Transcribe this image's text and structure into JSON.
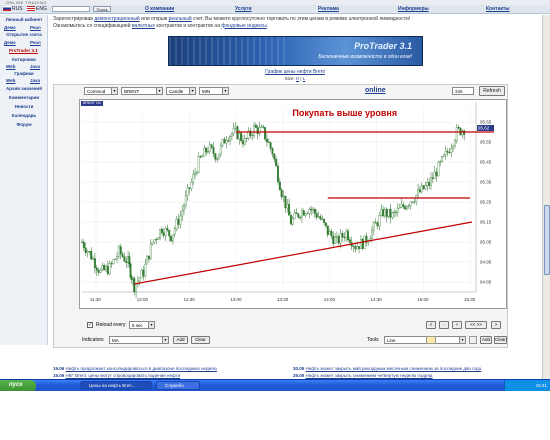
{
  "site": {
    "logo_text": "ONLINE TRADING"
  },
  "language": {
    "ru": "RUS",
    "en": "ENG"
  },
  "nav": {
    "search_button": "Поиск",
    "items": [
      "О компании",
      "Услуги",
      "Реклама",
      "Информеры",
      "Контакты"
    ]
  },
  "sidebar": {
    "sections": [
      {
        "title": "Личный кабинет",
        "links": [
          "Демо",
          "Реал"
        ]
      },
      {
        "title": "Открытие счета",
        "links": [
          "Демо",
          "Реал"
        ]
      },
      {
        "title": "",
        "links": [
          "ProTrader 3.1"
        ]
      },
      {
        "title": "Котировки",
        "links": [
          "Web",
          "Java"
        ]
      },
      {
        "title": "Графики",
        "links": [
          "Web",
          "Java"
        ]
      },
      {
        "title": "Архив значений",
        "links": []
      },
      {
        "title": "Комментарии",
        "links": []
      },
      {
        "title": "Новости",
        "links": []
      },
      {
        "title": "Календарь",
        "links": []
      },
      {
        "title": "Форум",
        "links": []
      }
    ]
  },
  "intro": {
    "line1_a": "Зарегистрировав ",
    "line1_link1": "демонстрационный",
    "line1_b": " или открыв ",
    "line1_link2": "реальный",
    "line1_c": " счет, Вы можете круглосуточно торговать по этим ценам в режиме электронной ликвидности!",
    "line2_a": "Ознакомьтесь со спецификацией ",
    "line2_link1": "валютных",
    "line2_b": " контрактов и контрактов на ",
    "line2_link2": "фондовые индексы",
    "line2_c": "."
  },
  "banner": {
    "title": "ProTrader 3.1",
    "subtitle": "Бесконечные возможности в один клик!"
  },
  "chart_header": {
    "title": "График цены нефти Brent",
    "size_label": "Size:",
    "size_h": "H",
    "size_l": "L"
  },
  "controls": {
    "type": "Commod",
    "symbol": "BRENT",
    "style": "Candle",
    "interval": "MIN",
    "online": "online",
    "periods": "336",
    "refresh": "Refresh",
    "reload_label": "Reload every",
    "reload_value": "5 sec",
    "reload_checked": true,
    "indicators_label": "Indicators",
    "indicator_value": "MA",
    "add": "Add",
    "clear": "Clear",
    "tools_label": "Tools",
    "tool_value": "Line",
    "nav_buttons": [
      "<",
      "-",
      "+",
      "<< >>",
      ">"
    ]
  },
  "chart_data": {
    "type": "candlestick",
    "symbol_tag": "BRENT 1M",
    "annotation": "Покупать выше уровня",
    "x_ticks": [
      "11:30",
      "12:00",
      "12:30",
      "13:00",
      "13:30",
      "14:00",
      "14:30",
      "15:00",
      "15:30"
    ],
    "y_ticks": [
      "94.85",
      "94.95",
      "95.05",
      "95.15",
      "95.25",
      "95.35",
      "95.45",
      "95.55",
      "95.65"
    ],
    "ylim": [
      94.8,
      95.72
    ],
    "last_price": "95.62",
    "close_path": [
      [
        0,
        95.05
      ],
      [
        6,
        94.98
      ],
      [
        12,
        94.9
      ],
      [
        18,
        94.92
      ],
      [
        24,
        95.0
      ],
      [
        30,
        94.95
      ],
      [
        34,
        94.83
      ],
      [
        40,
        94.9
      ],
      [
        46,
        95.05
      ],
      [
        52,
        95.12
      ],
      [
        58,
        95.08
      ],
      [
        64,
        95.18
      ],
      [
        70,
        95.32
      ],
      [
        76,
        95.45
      ],
      [
        82,
        95.52
      ],
      [
        88,
        95.48
      ],
      [
        94,
        95.58
      ],
      [
        100,
        95.6
      ],
      [
        106,
        95.55
      ],
      [
        112,
        95.62
      ],
      [
        118,
        95.6
      ],
      [
        124,
        95.5
      ],
      [
        130,
        95.3
      ],
      [
        136,
        95.15
      ],
      [
        142,
        95.2
      ],
      [
        148,
        95.22
      ],
      [
        154,
        95.18
      ],
      [
        160,
        95.1
      ],
      [
        166,
        95.05
      ],
      [
        172,
        95.1
      ],
      [
        178,
        95.03
      ],
      [
        184,
        95.05
      ],
      [
        190,
        95.12
      ],
      [
        196,
        95.2
      ],
      [
        202,
        95.18
      ],
      [
        208,
        95.22
      ],
      [
        214,
        95.26
      ],
      [
        220,
        95.3
      ],
      [
        226,
        95.34
      ],
      [
        232,
        95.42
      ],
      [
        238,
        95.5
      ],
      [
        244,
        95.6
      ],
      [
        250,
        95.62
      ]
    ],
    "lines": [
      {
        "name": "resistance",
        "color": "#c00000"
      },
      {
        "name": "level",
        "color": "#c00000"
      },
      {
        "name": "trend",
        "color": "#c00000"
      }
    ]
  },
  "news": [
    {
      "date": "19.06",
      "text": "Нефть продолжает консолидироваться в диапазоне последнюю неделю"
    },
    {
      "date": "15.06",
      "text": "НКГ Brent: цены могут спровоцировать падение нефти"
    },
    {
      "date": "30.05",
      "text": "Нефть может закрыть май рекордным месячным снижением за последние два года"
    },
    {
      "date": "25.05",
      "text": "Нефть может закрыть снижением четвертую неделю подряд"
    }
  ],
  "taskbar": {
    "start": "пуск",
    "tasks": [
      "Цены на нефть Bren...",
      "Служебн"
    ],
    "clock": "15:41"
  },
  "colors": {
    "accent": "#1f3f8f",
    "annotation": "#c00000",
    "candle": "#2f7a2f"
  }
}
